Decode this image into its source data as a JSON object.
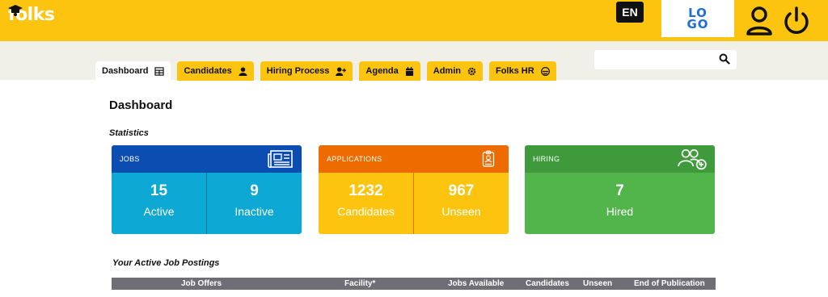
{
  "header": {
    "brand": "folks",
    "language": "EN",
    "logo_line1": "LO",
    "logo_line2": "GO",
    "colors": {
      "accent": "#fdc40f",
      "logo": "#1f6fd6"
    }
  },
  "nav": {
    "tabs": [
      {
        "label": "Dashboard",
        "icon": "table-icon",
        "active": true
      },
      {
        "label": "Candidates",
        "icon": "person-icon",
        "active": false
      },
      {
        "label": "Hiring Process",
        "icon": "person-plus-icon",
        "active": false
      },
      {
        "label": "Agenda",
        "icon": "calendar-icon",
        "active": false
      },
      {
        "label": "Admin",
        "icon": "gear-icon",
        "active": false
      },
      {
        "label": "Folks HR",
        "icon": "folks-hr-icon",
        "active": false
      }
    ],
    "search": {
      "value": "",
      "placeholder": ""
    }
  },
  "main": {
    "title": "Dashboard",
    "statistics_title": "Statistics",
    "cards": {
      "jobs": {
        "header": "JOBS",
        "icon": "newspaper-icon",
        "active_value": "15",
        "active_label": "Active",
        "inactive_value": "9",
        "inactive_label": "Inactive",
        "colors": {
          "head": "#0b4db0",
          "body": "#0ea8d4"
        }
      },
      "applications": {
        "header": "APPLICATIONS",
        "icon": "id-badge-icon",
        "candidates_value": "1232",
        "candidates_label": "Candidates",
        "unseen_value": "967",
        "unseen_label": "Unseen",
        "colors": {
          "head": "#ee6b00",
          "body": "#fdc40f"
        }
      },
      "hiring": {
        "header": "HIRING",
        "icon": "users-plus-icon",
        "hired_value": "7",
        "hired_label": "Hired",
        "colors": {
          "head": "#3f9a3b",
          "body": "#52b54c"
        }
      }
    },
    "postings_title": "Your Active Job Postings",
    "table_columns": [
      "Job Offers",
      "Facility*",
      "Jobs Available",
      "Candidates",
      "Unseen",
      "End of Publication"
    ]
  }
}
